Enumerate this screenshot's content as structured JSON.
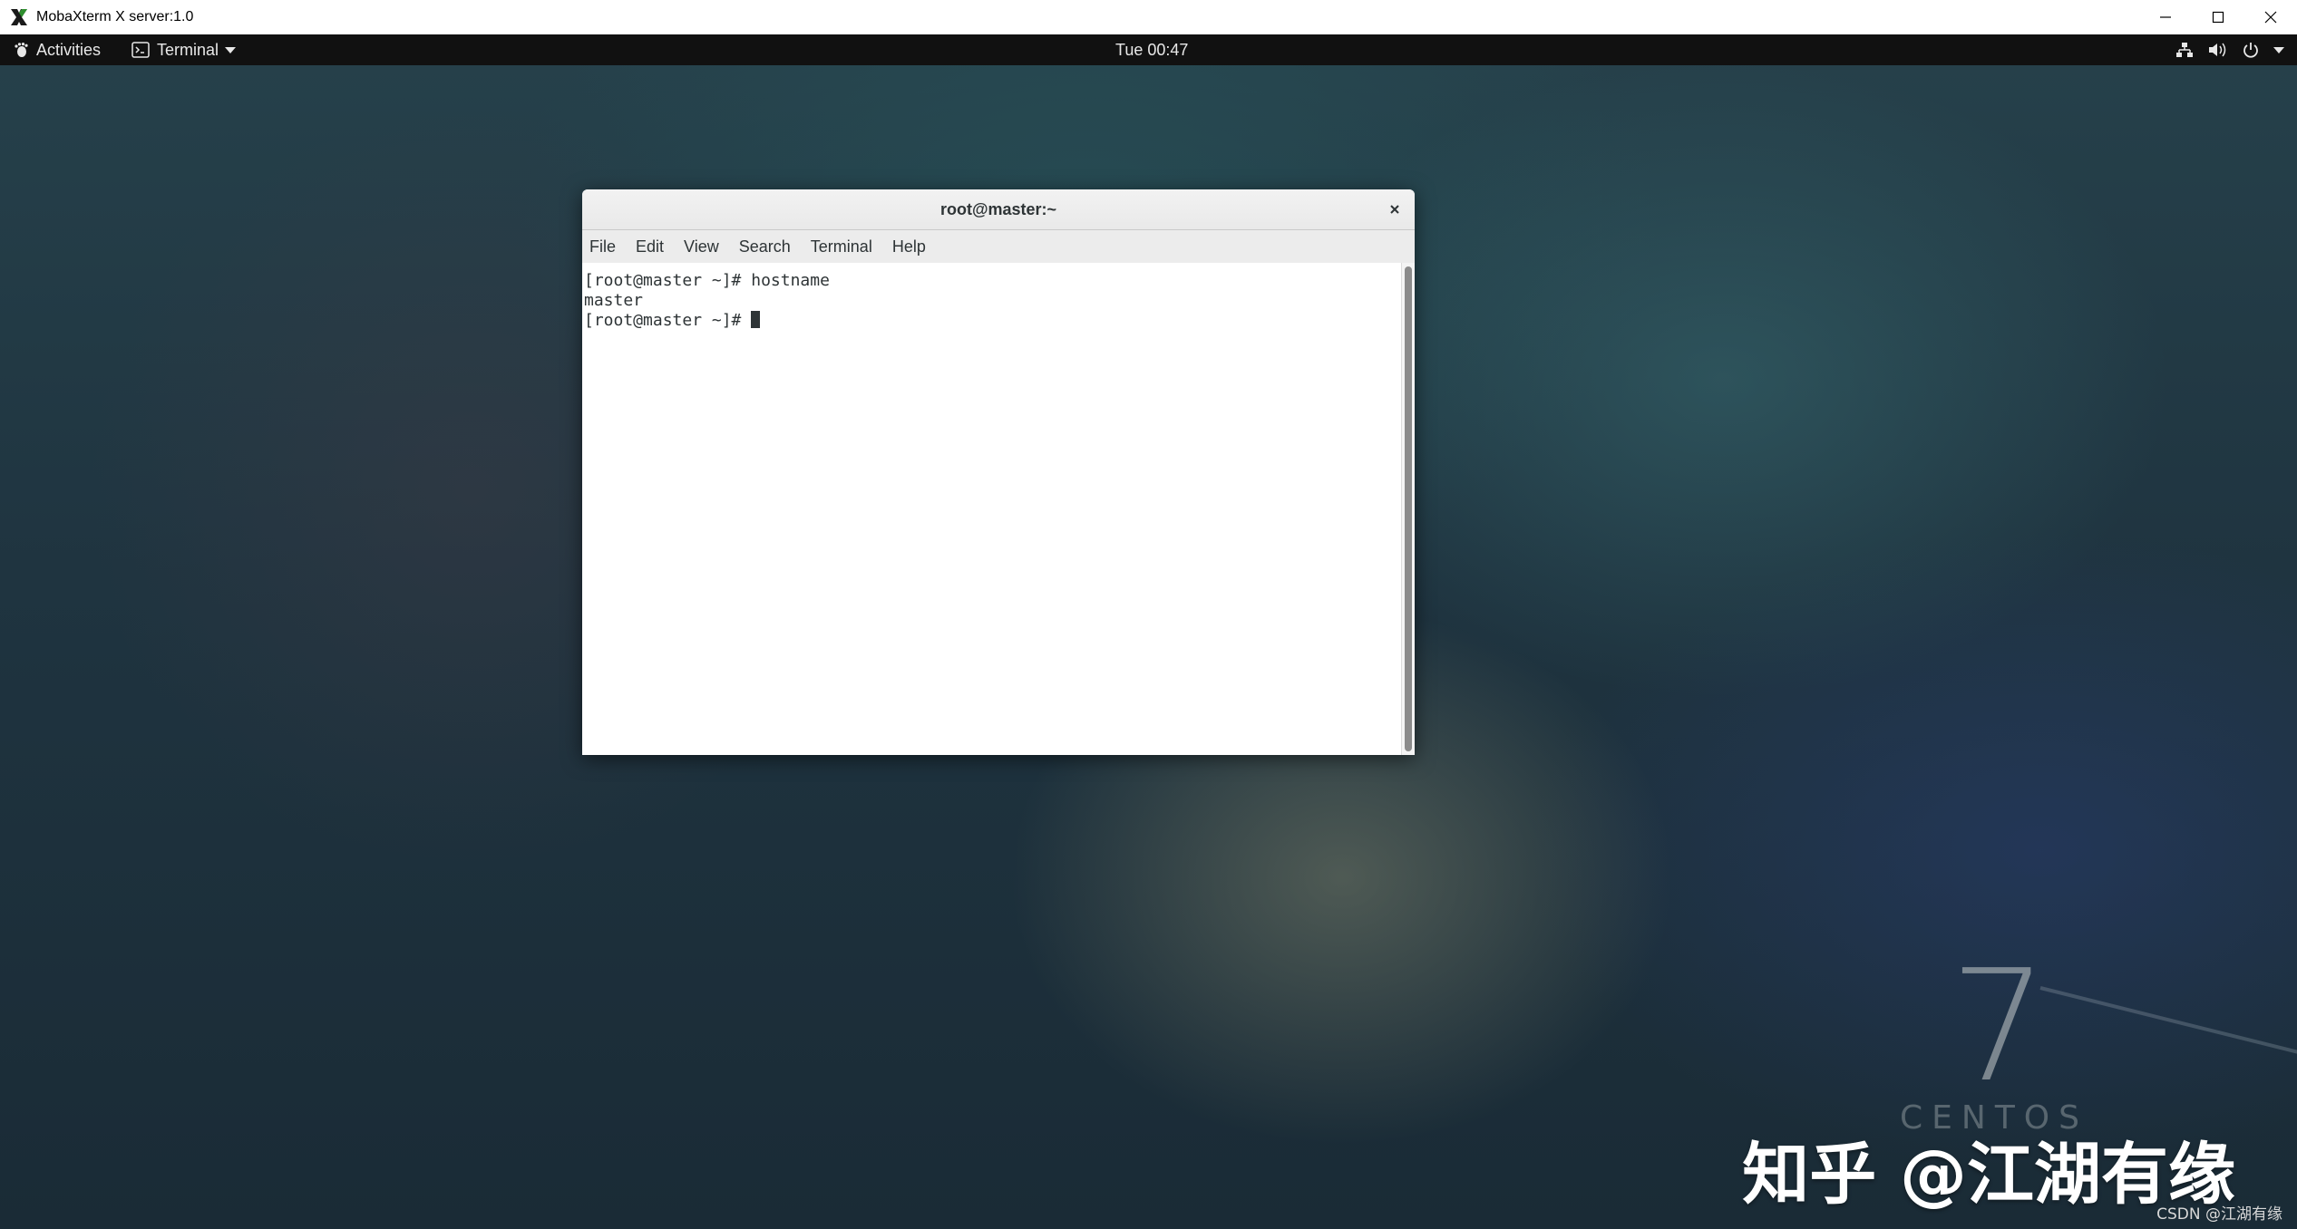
{
  "host_window": {
    "title": "MobaXterm X server:1.0",
    "logo_icon": "x-logo-icon",
    "controls": [
      "minimize-icon",
      "maximize-icon",
      "close-icon"
    ]
  },
  "top_bar": {
    "activities_label": "Activities",
    "app_menu_label": "Terminal",
    "clock": "Tue 00:47",
    "tray_icons": [
      "network-icon",
      "volume-icon",
      "power-icon",
      "chevron-down-icon"
    ]
  },
  "terminal": {
    "title": "root@master:~",
    "menu": [
      "File",
      "Edit",
      "View",
      "Search",
      "Terminal",
      "Help"
    ],
    "lines": [
      "[root@master ~]# hostname",
      "master"
    ],
    "prompt": "[root@master ~]# "
  },
  "wallpaper": {
    "version_digit": "7",
    "brand_word": "CENTOS"
  },
  "watermarks": {
    "zhihu": "知乎 @江湖有缘",
    "csdn": "CSDN @江湖有缘"
  }
}
